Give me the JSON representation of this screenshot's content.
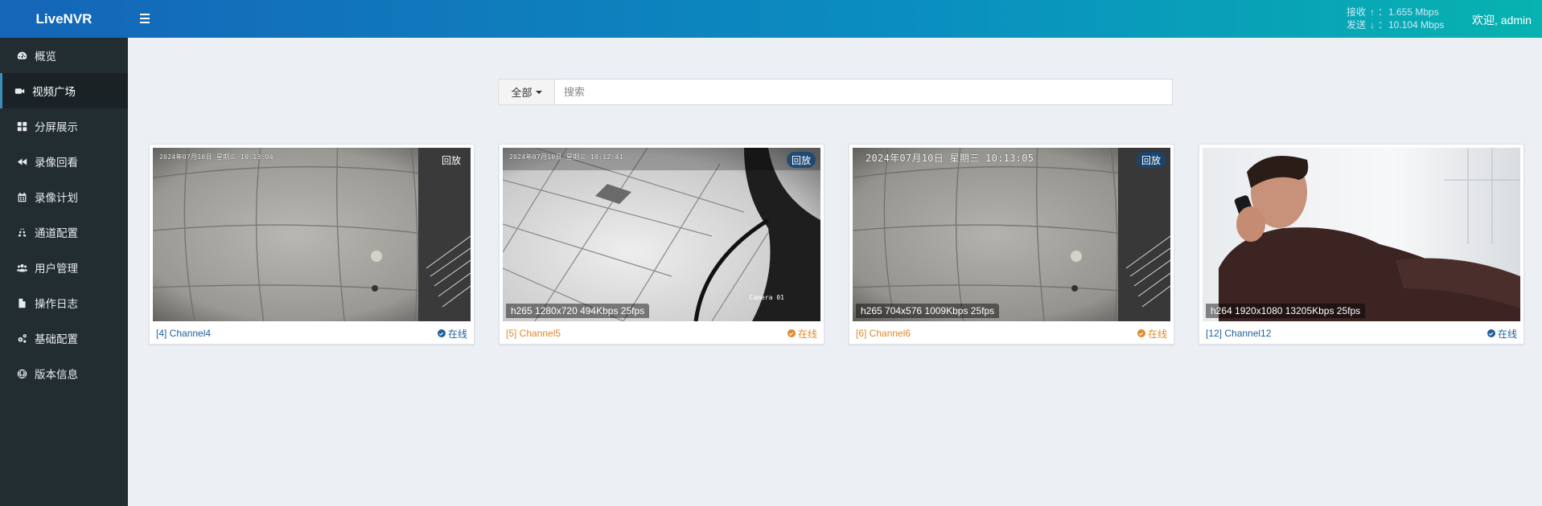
{
  "app": {
    "logo": "LiveNVR"
  },
  "header": {
    "net": {
      "recv_label": "接收",
      "recv_arrow": "↑",
      "recv_value": "1.655 Mbps",
      "send_label": "发送",
      "send_arrow": "↓",
      "send_value": "10.104 Mbps",
      "colon": "："
    },
    "welcome": "欢迎, admin"
  },
  "sidebar": {
    "items": [
      {
        "label": "概览",
        "icon": "dashboard-icon"
      },
      {
        "label": "视频广场",
        "icon": "video-camera-icon"
      },
      {
        "label": "分屏展示",
        "icon": "grid-icon"
      },
      {
        "label": "录像回看",
        "icon": "backward-icon"
      },
      {
        "label": "录像计划",
        "icon": "calendar-icon"
      },
      {
        "label": "通道配置",
        "icon": "road-icon"
      },
      {
        "label": "用户管理",
        "icon": "users-icon"
      },
      {
        "label": "操作日志",
        "icon": "file-icon"
      },
      {
        "label": "基础配置",
        "icon": "cogs-icon"
      },
      {
        "label": "版本信息",
        "icon": "globe-icon"
      }
    ],
    "active": 1
  },
  "search": {
    "filter_label": "全部",
    "placeholder": "搜索",
    "value": ""
  },
  "colors": {
    "accent": "#3c8dbc",
    "online_blue": "#1f5f9c",
    "online_orange": "#e08a2a",
    "sidebar": "#222d32"
  },
  "cards": [
    {
      "osd": "2024年07月10日  星期三  10:13:04",
      "playback": "回放",
      "info": "",
      "name": "[4] Channel4",
      "status": "在线",
      "color": "#1f5f9c"
    },
    {
      "osd": "2024年07月10日  星期三  10:12:41",
      "playback": "回放",
      "info": "h265 1280x720 494Kbps 25fps",
      "name": "[5] Channel5",
      "status": "在线",
      "color": "#e08a2a",
      "cam_label": "Camera 01"
    },
    {
      "osd": "2024年07月10日  星期三  10:13:05",
      "playback": "回放",
      "info": "h265 704x576 1009Kbps 25fps",
      "name": "[6] Channel6",
      "status": "在线",
      "color": "#e08a2a"
    },
    {
      "osd": "",
      "playback": "",
      "info": "h264 1920x1080 13205Kbps 25fps",
      "name": "[12] Channel12",
      "status": "在线",
      "color": "#1f5f9c"
    }
  ]
}
